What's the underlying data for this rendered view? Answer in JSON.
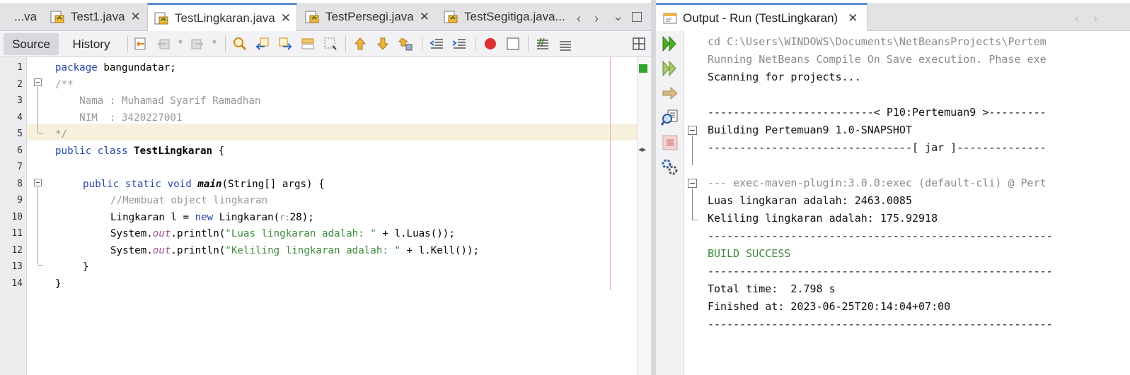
{
  "editor": {
    "tabs": [
      {
        "label": "...va"
      },
      {
        "label": "Test1.java"
      },
      {
        "label": "TestLingkaran.java",
        "active": true
      },
      {
        "label": "TestPersegi.java"
      },
      {
        "label": "TestSegitiga.java..."
      }
    ],
    "view_tabs": {
      "source": "Source",
      "history": "History"
    },
    "line_numbers": [
      "1",
      "2",
      "3",
      "4",
      "5",
      "6",
      "7",
      "8",
      "9",
      "10",
      "11",
      "12",
      "13",
      "14"
    ],
    "code": {
      "l1_kw": "package",
      "l1_rest": " bangundatar;",
      "l2": "/**",
      "l3": "    Nama : Muhamad Syarif Ramadhan",
      "l4": "    NIM  : 3420227001",
      "l5": "*/",
      "l6_kw1": "public",
      "l6_kw2": "class",
      "l6_name": "TestLingkaran",
      "l6_rest": " {",
      "l8_kw": "public static void",
      "l8_name": "main",
      "l8_rest": "(String[] args) {",
      "l9": "//Membuat object lingkaran",
      "l10_pre": "Lingkaran l = ",
      "l10_kw": "new",
      "l10_mid": " Lingkaran(",
      "l10_hint": "r:",
      "l10_post": "28);",
      "l11_pre": "System.",
      "l11_fld": "out",
      "l11_mid": ".println(",
      "l11_str": "\"Luas lingkaran adalah: \"",
      "l11_post": " + l.Luas());",
      "l12_pre": "System.",
      "l12_fld": "out",
      "l12_mid": ".println(",
      "l12_str": "\"Keliling lingkaran adalah: \"",
      "l12_post": " + l.Kell());",
      "l13": "}",
      "l14": "}"
    }
  },
  "output": {
    "tab_label": "Output - Run (TestLingkaran)",
    "lines": {
      "o1": "cd C:\\Users\\WINDOWS\\Documents\\NetBeansProjects\\Pertem",
      "o2": "Running NetBeans Compile On Save execution. Phase exe",
      "o3": "Scanning for projects...",
      "o5": "--------------------------< P10:Pertemuan9 >---------",
      "o6": "Building Pertemuan9 1.0-SNAPSHOT",
      "o7": "--------------------------------[ jar ]--------------",
      "o9": "--- exec-maven-plugin:3.0.0:exec (default-cli) @ Pert",
      "o10": "Luas lingkaran adalah: 2463.0085",
      "o11": "Keliling lingkaran adalah: 175.92918",
      "o12": "------------------------------------------------------",
      "o13": "BUILD SUCCESS",
      "o14": "------------------------------------------------------",
      "o15": "Total time:  2.798 s",
      "o16": "Finished at: 2023-06-25T20:14:04+07:00",
      "o17": "------------------------------------------------------"
    }
  },
  "colors": {
    "keyword": "#2546a8",
    "comment": "#969696",
    "string": "#3d8b3d",
    "field": "#a0528c",
    "success": "#3d8b3d"
  }
}
